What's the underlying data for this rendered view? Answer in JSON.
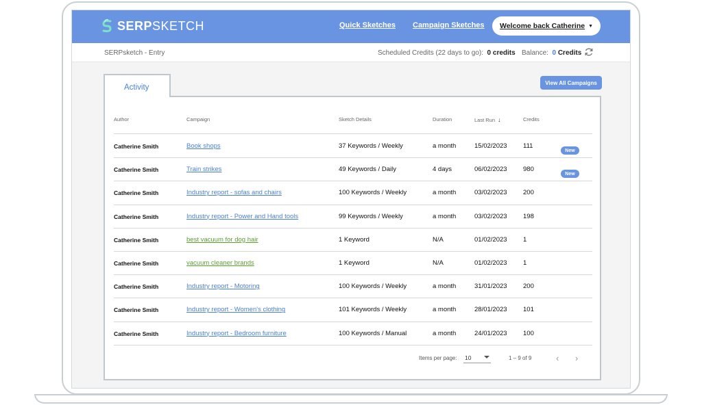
{
  "brand": {
    "logo_bold": "SERP",
    "logo_light": "SKETCH"
  },
  "nav": {
    "quick": "Quick Sketches",
    "campaign": "Campaign Sketches",
    "welcome": "Welcome back Catherine"
  },
  "subbar": {
    "crumb": "SERPsketch - Entry",
    "scheduled_label": "Scheduled Credits (22 days to go):",
    "scheduled_value": "0 credits",
    "balance_label": "Balance:",
    "balance_value": "0",
    "balance_unit": "Credits"
  },
  "tab": "Activity",
  "view_all": "View All Campaigns",
  "columns": {
    "author": "Author",
    "campaign": "Campaign",
    "details": "Sketch Details",
    "duration": "Duration",
    "lastrun": "Last Run",
    "credits": "Credits"
  },
  "rows": [
    {
      "author": "Catherine Smith",
      "campaign": "Book shops",
      "details": "37 Keywords / Weekly",
      "duration": "a month",
      "lastrun": "15/02/2023",
      "credits": "111",
      "badge": "New"
    },
    {
      "author": "Catherine Smith",
      "campaign": "Train strikes",
      "details": "49 Keywords / Daily",
      "duration": "4 days",
      "lastrun": "06/02/2023",
      "credits": "980",
      "badge": "New"
    },
    {
      "author": "Catherine Smith",
      "campaign": "Industry report - sofas and chairs",
      "details": "100 Keywords / Weekly",
      "duration": "a month",
      "lastrun": "03/02/2023",
      "credits": "200",
      "badge": ""
    },
    {
      "author": "Catherine Smith",
      "campaign": "Industry report - Power and Hand tools",
      "details": "99 Keywords / Weekly",
      "duration": "a month",
      "lastrun": "03/02/2023",
      "credits": "198",
      "badge": ""
    },
    {
      "author": "Catherine Smith",
      "campaign": "best vacuum for dog hair",
      "details": "1 Keyword",
      "duration": "N/A",
      "lastrun": "01/02/2023",
      "credits": "1",
      "badge": ""
    },
    {
      "author": "Catherine Smith",
      "campaign": "vacuum cleaner brands",
      "details": "1 Keyword",
      "duration": "N/A",
      "lastrun": "01/02/2023",
      "credits": "1",
      "badge": ""
    },
    {
      "author": "Catherine Smith",
      "campaign": "Industry report - Motoring",
      "details": "100 Keywords / Weekly",
      "duration": "a month",
      "lastrun": "31/01/2023",
      "credits": "200",
      "badge": ""
    },
    {
      "author": "Catherine Smith",
      "campaign": "Industry report - Women's clothing",
      "details": "101 Keywords / Weekly",
      "duration": "a month",
      "lastrun": "28/01/2023",
      "credits": "101",
      "badge": ""
    },
    {
      "author": "Catherine Smith",
      "campaign": "Industry report - Bedroom furniture",
      "details": "100 Keywords / Manual",
      "duration": "a month",
      "lastrun": "24/01/2023",
      "credits": "100",
      "badge": ""
    }
  ],
  "row_link_colors": [
    "#4a7fd9",
    "#4a7fd9",
    "#4a7fd9",
    "#4a7fd9",
    "#5a9e2f",
    "#5a9e2f",
    "#4a7fd9",
    "#4a7fd9",
    "#4a7fd9"
  ],
  "pager": {
    "label": "Items per page:",
    "size": "10",
    "range": "1 – 9 of 9",
    "prev": "‹",
    "next": "›"
  },
  "colors": {
    "brand": "#6994e2",
    "link_blue": "#4a7fd9",
    "link_green": "#5a9e2f"
  }
}
